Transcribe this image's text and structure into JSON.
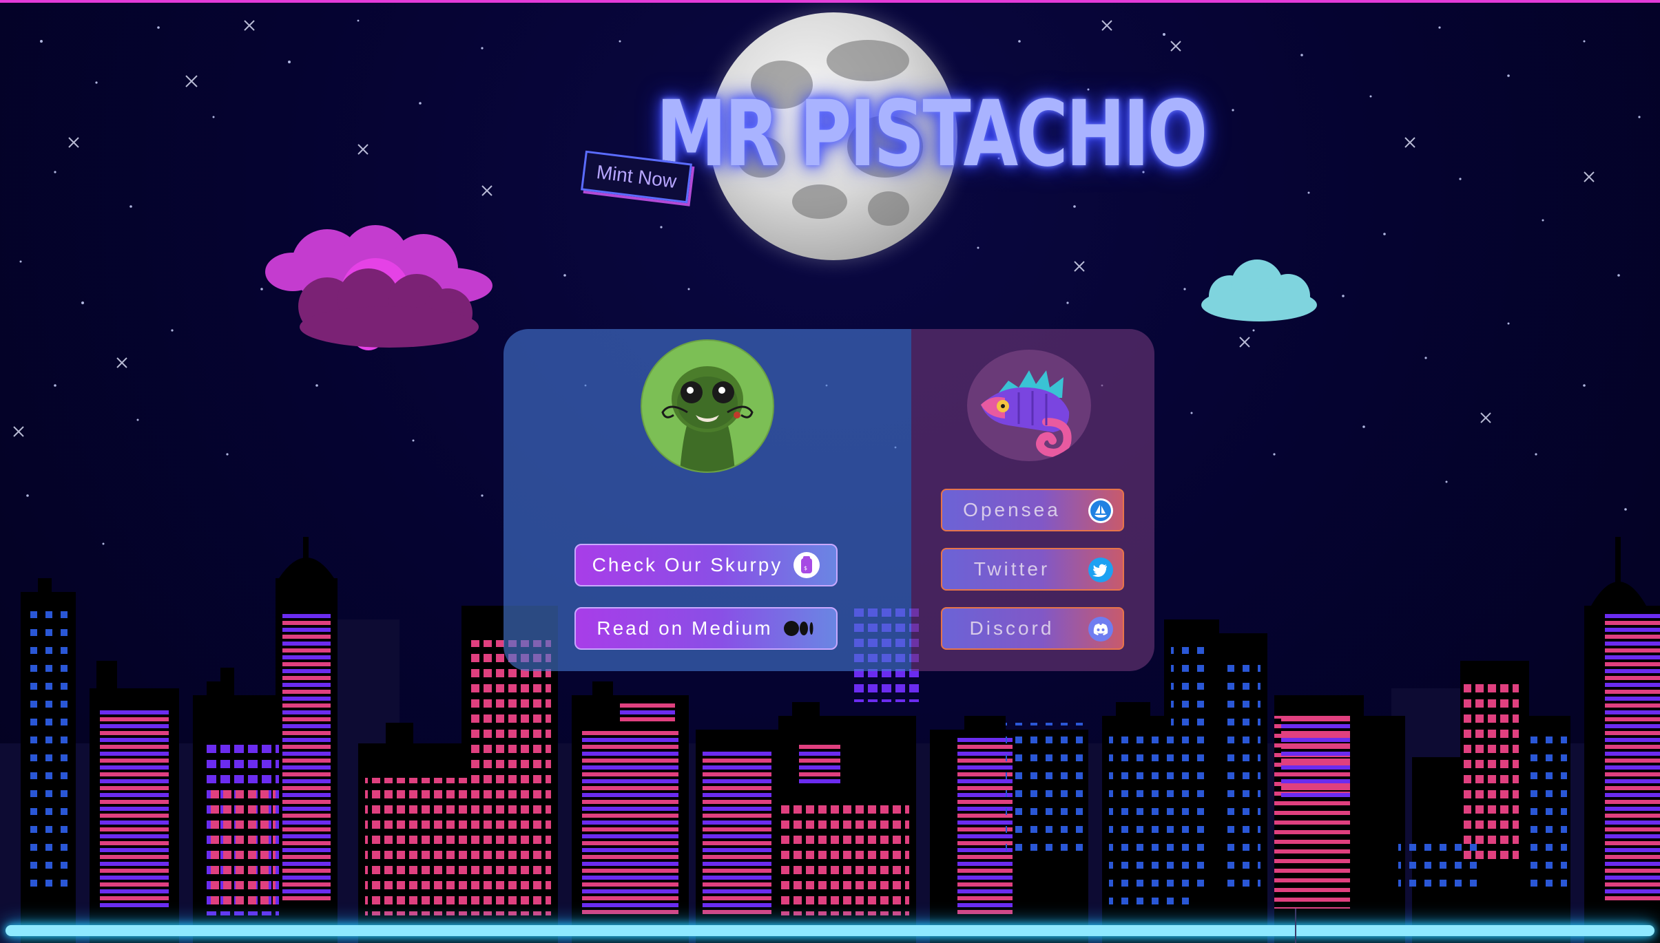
{
  "site": {
    "title": "MR PISTACHIO",
    "mint_label": "Mint Now"
  },
  "left_panel": {
    "avatar_icon": "lizard-portrait-icon",
    "skurpy_label": "Check Our Skurpy",
    "skurpy_icon": "skurpy-icon",
    "medium_label": "Read on Medium",
    "medium_icon": "medium-icon"
  },
  "right_panel": {
    "avatar_icon": "chameleon-logo-icon",
    "links": [
      {
        "label": "Opensea",
        "icon": "opensea-icon"
      },
      {
        "label": "Twitter",
        "icon": "twitter-icon"
      },
      {
        "label": "Discord",
        "icon": "discord-icon"
      }
    ]
  },
  "colors": {
    "sky": "#050331",
    "title_glow": "#a9b3ff",
    "pink_window": "#e0407f",
    "purple_window": "#6b2cf0",
    "ground_glow": "#8fe9ff",
    "pink_cloud": "#c73ad0",
    "cyan_cloud": "#7fd4de"
  }
}
